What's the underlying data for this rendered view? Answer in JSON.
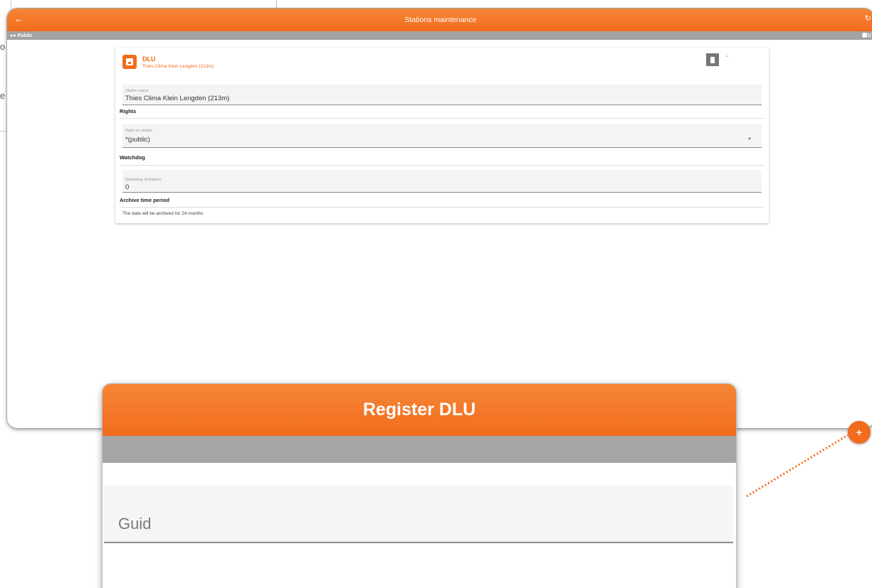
{
  "background": {
    "left_frag_1": "o",
    "left_frag_2": "e"
  },
  "window": {
    "title": "Stations maintenance",
    "back_icon": "arrow-left-icon",
    "subbar": {
      "group_label": "Public",
      "right_label": "␸1/"
    }
  },
  "card": {
    "title": "DLU",
    "subtitle": "Thies Clima Klein Lengden (213m)",
    "station_name": {
      "label": "Station name",
      "value": "Thies Clima Klein Lengden (213m)"
    },
    "rights_section": "Rights",
    "right_on_station": {
      "label": "Right on station",
      "value": "*(public)"
    },
    "watchdog_section": "Watchdog",
    "watchdog_definitions": {
      "label": "Watchdog definitions",
      "value": "0"
    },
    "archive_section": "Archive time period",
    "archive_note": "The data will be archived for 24 months"
  },
  "dialog": {
    "title": "Register DLU",
    "guid_placeholder": "Guid"
  },
  "fab": {
    "label": "+"
  },
  "colors": {
    "accent": "#f26c1d",
    "subbar": "#a3a3a3"
  }
}
